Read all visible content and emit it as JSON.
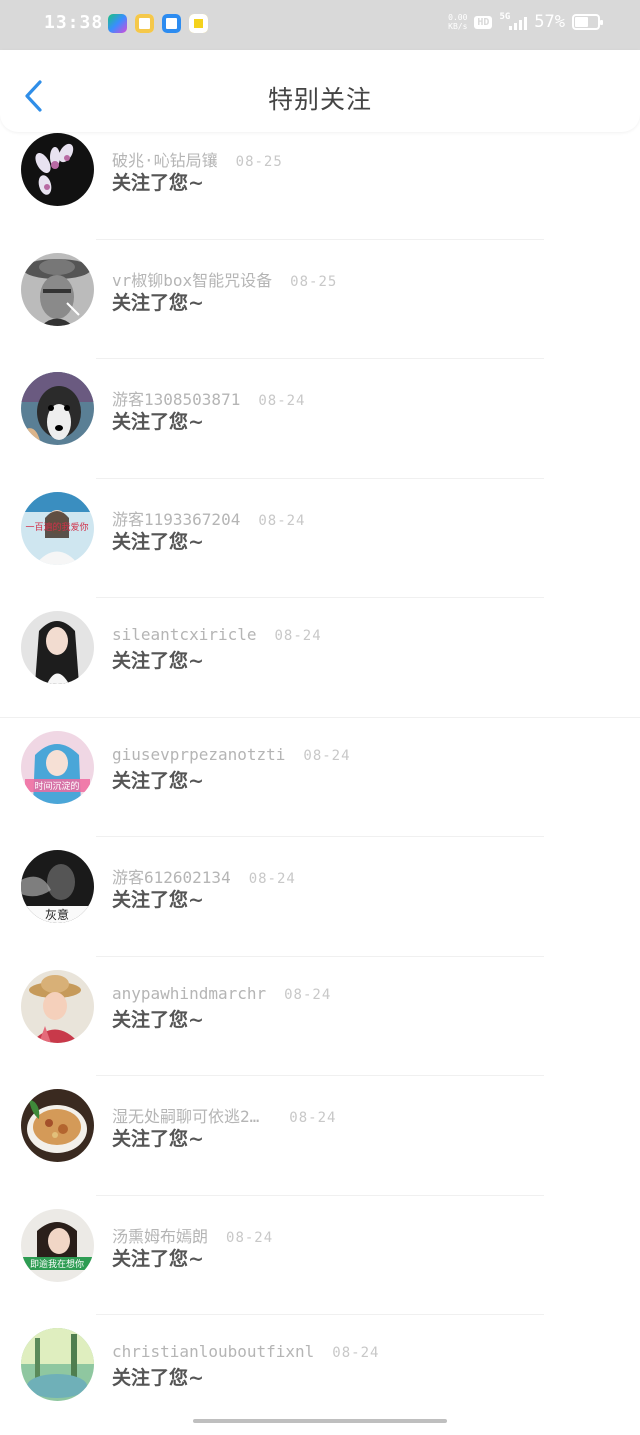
{
  "status": {
    "time": "13:38",
    "net_speed_top": "0.00",
    "net_speed_unit": "KB/s",
    "hd": "HD",
    "network": "5G",
    "battery": "57%"
  },
  "header": {
    "title": "特别关注"
  },
  "items": [
    {
      "name": "破兆·吣钻局镶",
      "date": "08-25",
      "message": "关注了您~",
      "avatar": "orchid-flowers"
    },
    {
      "name": "vr椒铆box智能咒设备",
      "date": "08-25",
      "message": "关注了您~",
      "avatar": "man-with-hat"
    },
    {
      "name": "游客1308503871",
      "date": "08-24",
      "message": "关注了您~",
      "avatar": "husky-dog"
    },
    {
      "name": "游客1193367204",
      "date": "08-24",
      "message": "关注了您~",
      "avatar": "girl-with-caption"
    },
    {
      "name": "sileantcxiricle",
      "date": "08-24",
      "message": "关注了您~",
      "avatar": "girl-dark-hair"
    },
    {
      "name": "giusevprpezanotzti",
      "date": "08-24",
      "message": "关注了您~",
      "avatar": "girl-blue-hood"
    },
    {
      "name": "游客612602134",
      "date": "08-24",
      "message": "关注了您~",
      "avatar": "smoke-portrait"
    },
    {
      "name": "anypawhindmarchr",
      "date": "08-24",
      "message": "关注了您~",
      "avatar": "child-straw-hat"
    },
    {
      "name": "湿无处嗣聊可依逃2…",
      "date": "08-24",
      "message": "关注了您~",
      "avatar": "food-bowl"
    },
    {
      "name": "汤熏姆布嫣朗",
      "date": "08-24",
      "message": "关注了您~",
      "avatar": "woman-green-banner"
    },
    {
      "name": "christianlouboutfixnl",
      "date": "08-24",
      "message": "关注了您~",
      "avatar": "forest-sunlight"
    }
  ],
  "captions": {
    "girl-with-caption": "一百遍的我爱你",
    "girl-blue-hood": "时间沉淀的",
    "smoke-portrait": "灰意",
    "woman-green-banner": "即逾我在想你"
  },
  "colors": {
    "status_bar": "#d9d9d9",
    "back_arrow": "#2f8ee8",
    "name_text": "#b5b5b5",
    "message_text": "#555555"
  }
}
